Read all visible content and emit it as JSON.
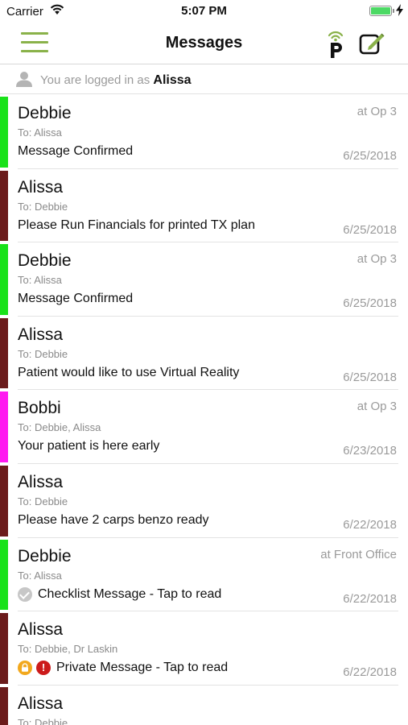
{
  "status_bar": {
    "carrier": "Carrier",
    "time": "5:07 PM",
    "battery_level": 1.0,
    "battery_color": "#4cd964"
  },
  "nav": {
    "title": "Messages",
    "menu_icon": "hamburger-menu-icon",
    "logo_icon": "p-broadcast-logo-icon",
    "compose_icon": "compose-icon",
    "accent": "#8ab24a"
  },
  "login": {
    "prefix": "You are logged in as",
    "user": "Alissa",
    "icon": "user-icon"
  },
  "messages": [
    {
      "sender": "Debbie",
      "to": "To: Alissa",
      "body": "Message Confirmed",
      "location": "at Op 3",
      "date": "6/25/2018",
      "bar_color": "#19e21a"
    },
    {
      "sender": "Alissa",
      "to": "To: Debbie",
      "body": "Please Run Financials for printed TX plan",
      "location": "",
      "date": "6/25/2018",
      "bar_color": "#6b1b1b"
    },
    {
      "sender": "Debbie",
      "to": "To: Alissa",
      "body": "Message Confirmed",
      "location": "at Op 3",
      "date": "6/25/2018",
      "bar_color": "#19e21a"
    },
    {
      "sender": "Alissa",
      "to": "To: Debbie",
      "body": "Patient would like to use Virtual Reality",
      "location": "",
      "date": "6/25/2018",
      "bar_color": "#6b1b1b"
    },
    {
      "sender": "Bobbi",
      "to": "To: Debbie, Alissa",
      "body": "Your patient is here early",
      "location": "at Op 3",
      "date": "6/23/2018",
      "bar_color": "#ff19f0"
    },
    {
      "sender": "Alissa",
      "to": "To: Debbie",
      "body": "Please have 2 carps benzo ready",
      "location": "",
      "date": "6/22/2018",
      "bar_color": "#6b1b1b"
    },
    {
      "sender": "Debbie",
      "to": "To: Alissa",
      "body": "Checklist Message - Tap to read",
      "location": "at Front Office",
      "date": "6/22/2018",
      "bar_color": "#19e21a",
      "icons": [
        "check-circle-icon"
      ]
    },
    {
      "sender": "Alissa",
      "to": "To: Debbie, Dr Laskin",
      "body": "Private Message - Tap to read",
      "location": "",
      "date": "6/22/2018",
      "bar_color": "#6b1b1b",
      "icons": [
        "lock-icon",
        "alert-icon"
      ]
    },
    {
      "sender": "Alissa",
      "to": "To: Debbie",
      "body": "",
      "location": "",
      "date": "",
      "bar_color": "#6b1b1b"
    }
  ]
}
